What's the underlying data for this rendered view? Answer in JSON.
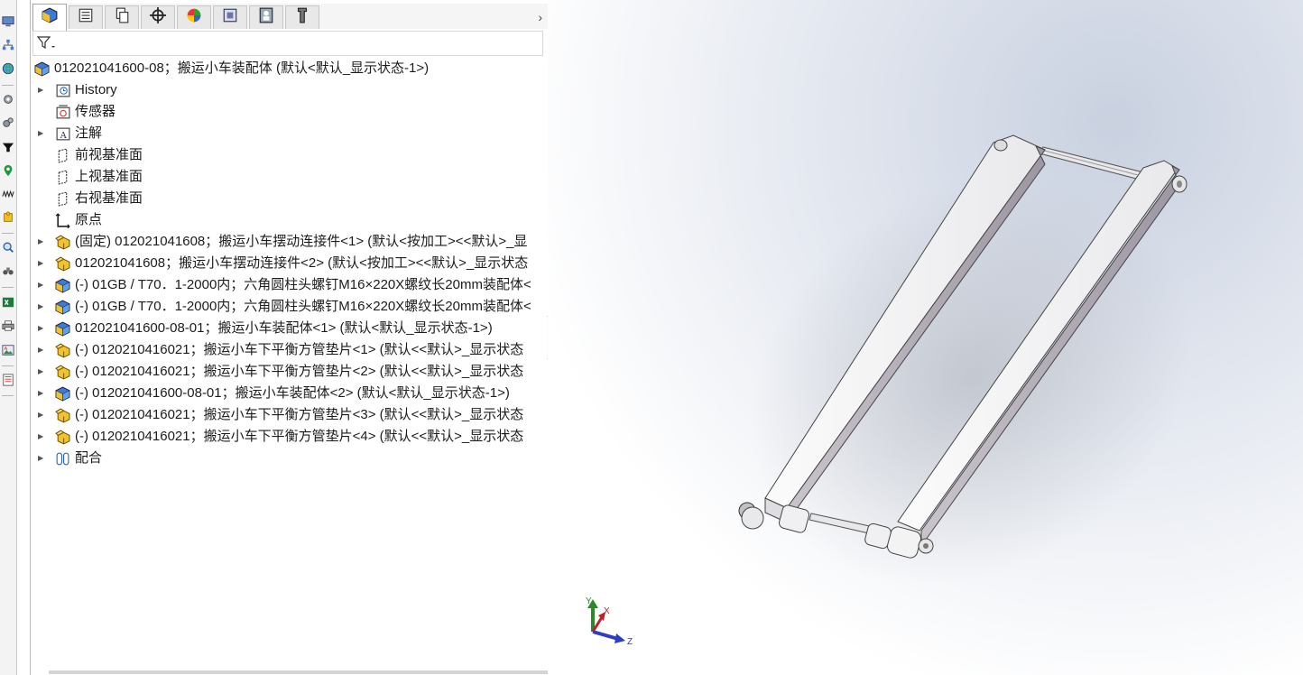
{
  "taskbar": {
    "items": [
      "monitor-icon",
      "network-icon",
      "globe-icon",
      "gear-icon",
      "gears-icon",
      "funnel-icon",
      "map-pin-icon",
      "spring-icon",
      "puzzle-icon",
      "search-doc-icon",
      "binoculars-icon",
      "excel-icon",
      "printer-icon",
      "image-icon",
      "list-icon"
    ]
  },
  "panel": {
    "tabs": [
      "feature-manager",
      "property-manager",
      "configuration-manager",
      "dimxpert-manager",
      "display-manager",
      "cam-manager",
      "appearance-manager",
      "tab-8"
    ],
    "scroll_arrow": "›",
    "root_label": "012021041600-08；搬运小车装配体 (默认<默认_显示状态-1>)",
    "items": [
      {
        "label": "History",
        "icon": "history-icon",
        "expandable": true
      },
      {
        "label": "传感器",
        "icon": "sensor-icon",
        "expandable": false
      },
      {
        "label": "注解",
        "icon": "annotation-icon",
        "expandable": true
      },
      {
        "label": "前视基准面",
        "icon": "plane-icon",
        "expandable": false
      },
      {
        "label": "上视基准面",
        "icon": "plane-icon",
        "expandable": false
      },
      {
        "label": "右视基准面",
        "icon": "plane-icon",
        "expandable": false
      },
      {
        "label": "原点",
        "icon": "origin-icon",
        "expandable": false
      },
      {
        "label": "(固定) 012021041608；搬运小车摆动连接件<1> (默认<按加工><<默认>_显",
        "icon": "part-icon",
        "expandable": true
      },
      {
        "label": "012021041608；搬运小车摆动连接件<2> (默认<按加工><<默认>_显示状态",
        "icon": "part-icon",
        "expandable": true
      },
      {
        "label": "(-) 01GB / T70．1-2000内；六角圆柱头螺钉M16×220X螺纹长20mm装配体<",
        "icon": "subassembly-icon",
        "expandable": true
      },
      {
        "label": "(-) 01GB / T70．1-2000内；六角圆柱头螺钉M16×220X螺纹长20mm装配体<",
        "icon": "subassembly-icon",
        "expandable": true
      },
      {
        "label": "012021041600-08-01；搬运小车装配体<1> (默认<默认_显示状态-1>)",
        "icon": "subassembly-icon",
        "expandable": true
      },
      {
        "label": "(-) 0120210416021；搬运小车下平衡方管垫片<1> (默认<<默认>_显示状态",
        "icon": "part-icon",
        "expandable": true
      },
      {
        "label": "(-) 0120210416021；搬运小车下平衡方管垫片<2> (默认<<默认>_显示状态",
        "icon": "part-icon",
        "expandable": true
      },
      {
        "label": "(-) 012021041600-08-01；搬运小车装配体<2> (默认<默认_显示状态-1>)",
        "icon": "subassembly-icon",
        "expandable": true
      },
      {
        "label": "(-) 0120210416021；搬运小车下平衡方管垫片<3> (默认<<默认>_显示状态",
        "icon": "part-icon",
        "expandable": true
      },
      {
        "label": "(-) 0120210416021；搬运小车下平衡方管垫片<4> (默认<<默认>_显示状态",
        "icon": "part-icon",
        "expandable": true
      },
      {
        "label": "配合",
        "icon": "mates-icon",
        "expandable": true
      }
    ]
  },
  "viewport": {
    "triad": {
      "x_label": "X",
      "y_label": "Y",
      "z_label": "Z"
    },
    "colors": {
      "x_axis": "#c0202a",
      "y_axis": "#2a8a2a",
      "z_axis": "#2c3fc4"
    }
  }
}
